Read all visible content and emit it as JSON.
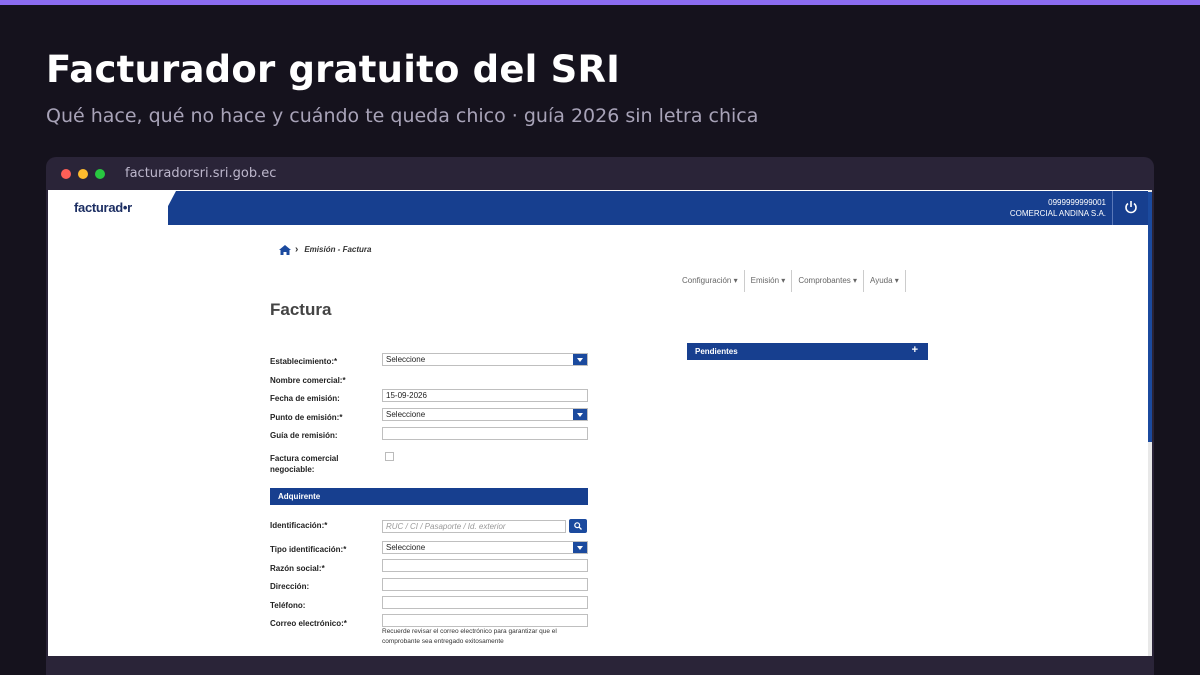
{
  "slide": {
    "title": "Facturador gratuito del SRI",
    "subtitle": "Qué hace, qué no hace y cuándo te queda chico · guía 2026 sin letra chica"
  },
  "browser": {
    "url": "facturadorsri.sri.gob.ec"
  },
  "app": {
    "logo": "facturad•r",
    "ruc": "0999999999001",
    "company": "COMERCIAL ANDINA S.A.",
    "breadcrumb": "Emisión - Factura",
    "menu": [
      "Configuración ▾",
      "Emisión ▾",
      "Comprobantes ▾",
      "Ayuda ▾"
    ],
    "page_title": "Factura",
    "form": {
      "establecimiento_label": "Establecimiento:*",
      "establecimiento_value": "Seleccione",
      "nombre_comercial_label": "Nombre comercial:*",
      "fecha_label": "Fecha de emisión:",
      "fecha_value": "15-09-2026",
      "punto_label": "Punto de emisión:*",
      "punto_value": "Seleccione",
      "guia_label": "Guía de remisión:",
      "factura_neg_label": "Factura comercial negociable:"
    },
    "adquirente": {
      "section_title": "Adquirente",
      "identificacion_label": "Identificación:*",
      "identificacion_placeholder": "RUC / CI / Pasaporte / Id. exterior",
      "tipo_label": "Tipo identificación:*",
      "tipo_value": "Seleccione",
      "razon_label": "Razón social:*",
      "direccion_label": "Dirección:",
      "telefono_label": "Teléfono:",
      "correo_label": "Correo electrónico:*",
      "correo_note": "Recuerde revisar el correo electrónico para garantizar que el comprobante sea entregado exitosamente"
    },
    "pendientes": {
      "title": "Pendientes",
      "expand_symbol": "+"
    }
  }
}
